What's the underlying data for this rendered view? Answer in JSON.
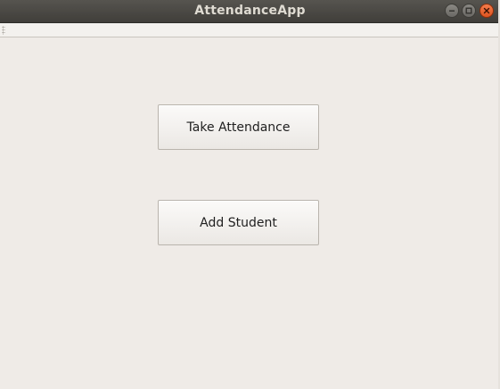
{
  "window": {
    "title": "AttendanceApp",
    "controls": {
      "minimize_icon": "minimize-icon",
      "maximize_icon": "maximize-icon",
      "close_icon": "close-icon"
    },
    "colors": {
      "titlebar": "#4a4844",
      "close_button": "#e95420",
      "background": "#efebe7"
    }
  },
  "main": {
    "buttons": {
      "take_attendance": "Take Attendance",
      "add_student": "Add Student"
    }
  }
}
